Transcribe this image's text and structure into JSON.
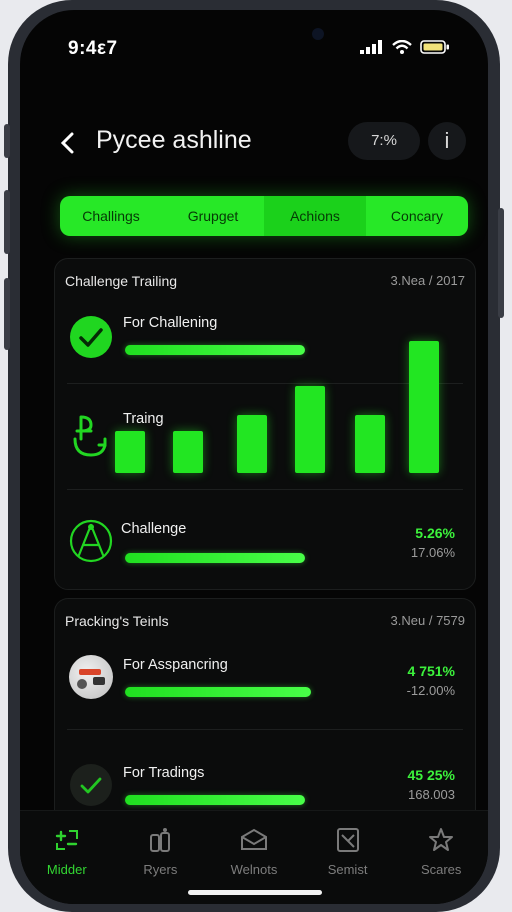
{
  "status": {
    "time": "9:4ε7"
  },
  "header": {
    "title": "Pycee ashline",
    "percent": "7:%",
    "info": "i"
  },
  "tabs": [
    {
      "label": "Challings",
      "active": false
    },
    {
      "label": "Grupget",
      "active": false
    },
    {
      "label": "Achions",
      "active": true
    },
    {
      "label": "Concary",
      "active": false
    }
  ],
  "card1": {
    "title": "Challenge Trailing",
    "date": "3.Nea / 2017",
    "rows": [
      {
        "label": "For Challening",
        "icon": "check-circle-icon",
        "progress": 0.6
      },
      {
        "label": "Traing",
        "icon": "stroller-icon"
      },
      {
        "label": "Challenge",
        "icon": "compass-icon",
        "progress": 0.6,
        "pct": "5.26%",
        "pct2": "17.06%"
      }
    ]
  },
  "chart_data": {
    "type": "bar",
    "categories": [
      "",
      "",
      "",
      "",
      "",
      ""
    ],
    "values": [
      38,
      38,
      52,
      78,
      52,
      118
    ],
    "ylim": [
      0,
      120
    ],
    "grid": false
  },
  "card2": {
    "title": "Pracking's Teinls",
    "date": "3.Neu / 7579",
    "rows": [
      {
        "label": "For Asspancring",
        "icon": "avatar",
        "progress": 0.62,
        "pct": "4 751%",
        "pct2": "-12.00%"
      },
      {
        "label": "For Tradings",
        "icon": "check-circle-icon",
        "progress": 0.6,
        "pct": "45 25%",
        "pct2": "168.003"
      }
    ]
  },
  "nav": [
    {
      "label": "Midder",
      "icon": "plus-minus-icon",
      "active": true
    },
    {
      "label": "Ryers",
      "icon": "people-icon",
      "active": false
    },
    {
      "label": "Welnots",
      "icon": "envelope-icon",
      "active": false
    },
    {
      "label": "Semist",
      "icon": "document-icon",
      "active": false
    },
    {
      "label": "Scares",
      "icon": "star-icon",
      "active": false
    }
  ],
  "colors": {
    "accent": "#22e622",
    "background": "#050505",
    "card": "#0b0c0c"
  }
}
